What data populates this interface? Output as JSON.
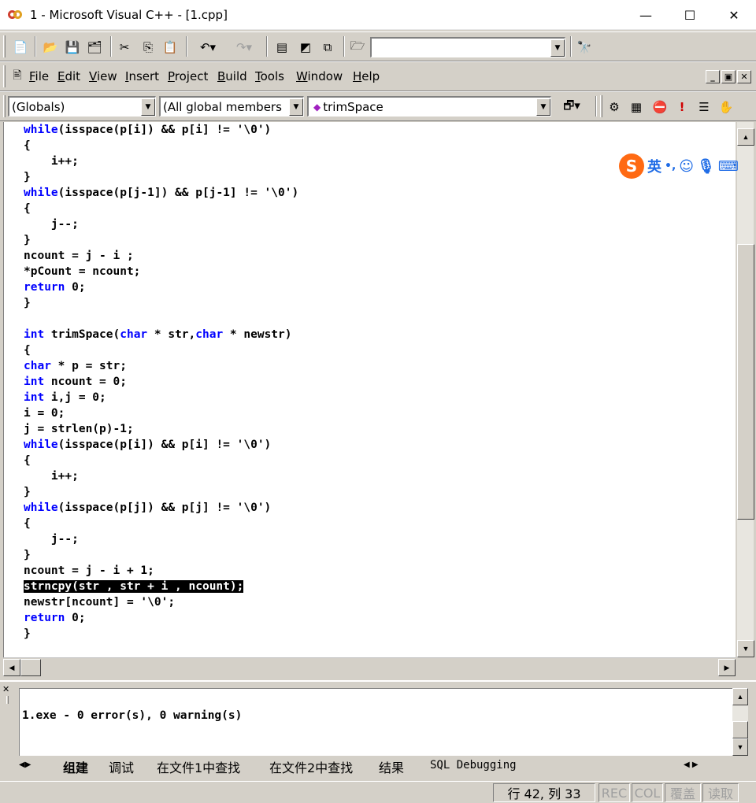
{
  "window": {
    "title": "1 - Microsoft Visual C++ - [1.cpp]",
    "minimize": "—",
    "maximize": "☐",
    "close": "✕"
  },
  "toolbar1": {
    "find_combo_value": "",
    "icons": [
      "new-text-file-icon",
      "open-icon",
      "save-icon",
      "save-all-icon",
      "cut-icon",
      "copy-icon",
      "paste-icon",
      "undo-icon",
      "redo-icon",
      "workspace-icon",
      "output-icon",
      "window-list-icon",
      "find-in-files-icon",
      "find-icon"
    ]
  },
  "menu": {
    "items": [
      {
        "label": "File",
        "key": "F"
      },
      {
        "label": "Edit",
        "key": "E"
      },
      {
        "label": "View",
        "key": "V"
      },
      {
        "label": "Insert",
        "key": "I"
      },
      {
        "label": "Project",
        "key": "P"
      },
      {
        "label": "Build",
        "key": "B"
      },
      {
        "label": "Tools",
        "key": "T"
      },
      {
        "label": "Window",
        "key": "W"
      },
      {
        "label": "Help",
        "key": "H"
      }
    ],
    "mdi_min": "_",
    "mdi_restore": "▣",
    "mdi_close": "✕"
  },
  "toolbar3": {
    "scope": "(Globals)",
    "filter": "(All global members",
    "function": "trimSpace",
    "icons": [
      "wizard-action-icon",
      "compile-icon",
      "build-icon",
      "stop-build-icon",
      "execute-icon",
      "insert-breakpoint-icon",
      "go-icon"
    ]
  },
  "editor": {
    "lines": [
      [
        {
          "t": "while",
          "k": 1
        },
        {
          "t": "(isspace(p[i]) && p[i] != '\\0')"
        }
      ],
      [
        {
          "t": "{"
        }
      ],
      [
        {
          "t": "    i++;"
        }
      ],
      [
        {
          "t": "}"
        }
      ],
      [
        {
          "t": "while",
          "k": 1
        },
        {
          "t": "(isspace(p[j-1]) && p[j-1] != '\\0')"
        }
      ],
      [
        {
          "t": "{"
        }
      ],
      [
        {
          "t": "    j--;"
        }
      ],
      [
        {
          "t": "}"
        }
      ],
      [
        {
          "t": "ncount = j - i ;"
        }
      ],
      [
        {
          "t": "*pCount = ncount;"
        }
      ],
      [
        {
          "t": "return",
          "k": 1
        },
        {
          "t": " 0;"
        }
      ],
      [
        {
          "t": "}"
        }
      ],
      [
        {
          "t": ""
        }
      ],
      [
        {
          "t": "int",
          "k": 1
        },
        {
          "t": " trimSpace("
        },
        {
          "t": "char",
          "k": 1
        },
        {
          "t": " * str,"
        },
        {
          "t": "char",
          "k": 1
        },
        {
          "t": " * newstr)"
        }
      ],
      [
        {
          "t": "{"
        }
      ],
      [
        {
          "t": "char",
          "k": 1
        },
        {
          "t": " * p = str;"
        }
      ],
      [
        {
          "t": "int",
          "k": 1
        },
        {
          "t": " ncount = 0;"
        }
      ],
      [
        {
          "t": "int",
          "k": 1
        },
        {
          "t": " i,j = 0;"
        }
      ],
      [
        {
          "t": "i = 0;"
        }
      ],
      [
        {
          "t": "j = strlen(p)-1;"
        }
      ],
      [
        {
          "t": "while",
          "k": 1
        },
        {
          "t": "(isspace(p[i]) && p[i] != '\\0')"
        }
      ],
      [
        {
          "t": "{"
        }
      ],
      [
        {
          "t": "    i++;"
        }
      ],
      [
        {
          "t": "}"
        }
      ],
      [
        {
          "t": "while",
          "k": 1
        },
        {
          "t": "(isspace(p[j]) && p[j] != '\\0')"
        }
      ],
      [
        {
          "t": "{"
        }
      ],
      [
        {
          "t": "    j--;"
        }
      ],
      [
        {
          "t": "}"
        }
      ],
      [
        {
          "t": "ncount = j - i + 1;"
        }
      ],
      [
        {
          "t": "strncpy(str , str + i , ncount);",
          "s": 1
        }
      ],
      [
        {
          "t": "newstr[ncount] = '\\0';"
        }
      ],
      [
        {
          "t": "return",
          "k": 1
        },
        {
          "t": " 0;"
        }
      ],
      [
        {
          "t": "}"
        }
      ]
    ]
  },
  "ime": {
    "logo": "S",
    "mode": "英",
    "punct": "•,",
    "icons": [
      "emoji-icon",
      "mic-icon",
      "keyboard-icon"
    ]
  },
  "output": {
    "text": "1.exe - 0 error(s), 0 warning(s)",
    "tabs": [
      "组建",
      "调试",
      "在文件1中查找",
      "在文件2中查找",
      "结果",
      "SQL Debugging"
    ]
  },
  "status": {
    "position": "行 42, 列 33",
    "rec": "REC",
    "col": "COL",
    "ovr": "覆盖",
    "read": "读取"
  }
}
